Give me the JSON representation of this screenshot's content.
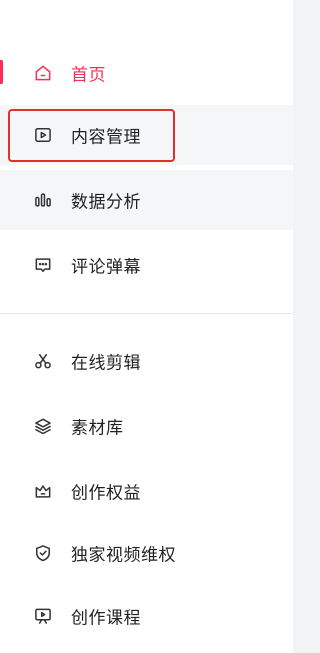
{
  "sidebar": {
    "items": [
      {
        "label": "首页",
        "icon": "home-icon",
        "active": true
      },
      {
        "label": "内容管理",
        "icon": "play-square-icon",
        "highlighted": true
      },
      {
        "label": "数据分析",
        "icon": "bar-chart-icon"
      },
      {
        "label": "评论弹幕",
        "icon": "comment-icon"
      },
      {
        "label": "在线剪辑",
        "icon": "scissors-icon"
      },
      {
        "label": "素材库",
        "icon": "layers-icon"
      },
      {
        "label": "创作权益",
        "icon": "crown-icon"
      },
      {
        "label": "独家视频维权",
        "icon": "shield-check-icon"
      },
      {
        "label": "创作课程",
        "icon": "course-icon"
      }
    ]
  },
  "colors": {
    "accent": "#fe2c55",
    "highlight_border": "#e0312a",
    "hover_bg": "#f5f6f8",
    "right_pane_bg": "#f2f3f5"
  }
}
